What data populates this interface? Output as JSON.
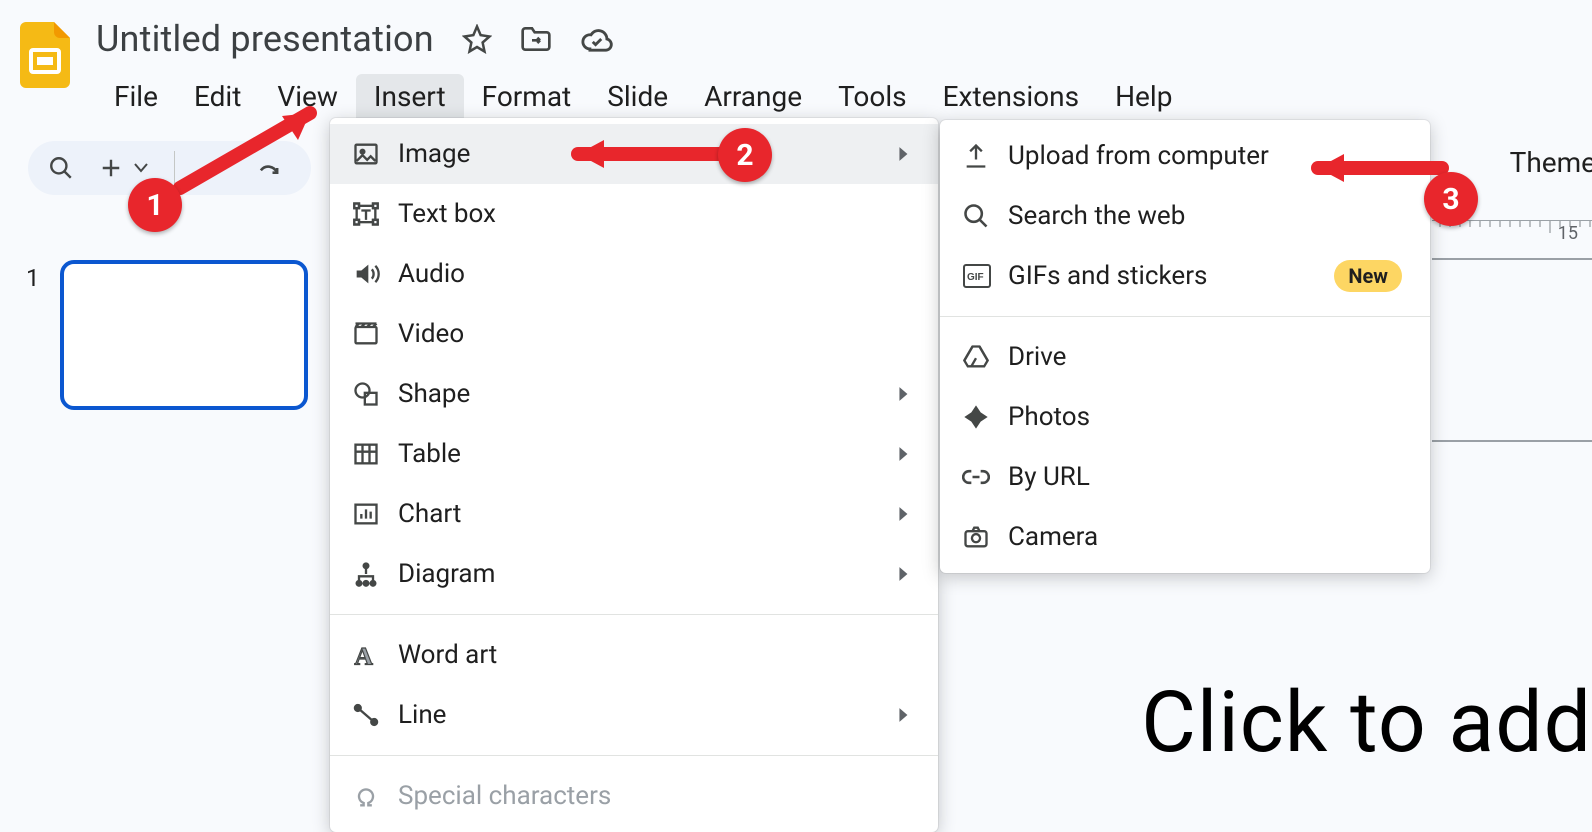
{
  "header": {
    "doc_title": "Untitled presentation"
  },
  "menubar": {
    "items": [
      "File",
      "Edit",
      "View",
      "Insert",
      "Format",
      "Slide",
      "Arrange",
      "Tools",
      "Extensions",
      "Help"
    ],
    "active_index": 3
  },
  "slide_panel": {
    "selected_slide_number": "1"
  },
  "insert_menu": {
    "items": [
      {
        "label": "Image",
        "icon": "image-icon",
        "has_submenu": true,
        "highlight": true
      },
      {
        "label": "Text box",
        "icon": "textbox-icon"
      },
      {
        "label": "Audio",
        "icon": "audio-icon"
      },
      {
        "label": "Video",
        "icon": "video-icon"
      },
      {
        "label": "Shape",
        "icon": "shape-icon",
        "has_submenu": true
      },
      {
        "label": "Table",
        "icon": "table-icon",
        "has_submenu": true
      },
      {
        "label": "Chart",
        "icon": "chart-icon",
        "has_submenu": true
      },
      {
        "label": "Diagram",
        "icon": "diagram-icon",
        "has_submenu": true
      },
      {
        "label": "Word art",
        "icon": "wordart-icon"
      },
      {
        "label": "Line",
        "icon": "line-icon",
        "has_submenu": true
      },
      {
        "label": "Special characters",
        "icon": "specialchars-icon",
        "disabled": true
      }
    ]
  },
  "image_submenu": {
    "group1": [
      {
        "label": "Upload from computer",
        "icon": "upload-icon"
      },
      {
        "label": "Search the web",
        "icon": "search-icon"
      },
      {
        "label": "GIFs and stickers",
        "icon": "gif-icon",
        "badge": "New"
      }
    ],
    "group2": [
      {
        "label": "Drive",
        "icon": "drive-icon"
      },
      {
        "label": "Photos",
        "icon": "photos-icon"
      },
      {
        "label": "By URL",
        "icon": "link-icon"
      },
      {
        "label": "Camera",
        "icon": "camera-icon"
      }
    ]
  },
  "canvas": {
    "title_placeholder": "Click to add",
    "theme_label": "Theme",
    "ruler_mark": "15"
  },
  "annotations": {
    "step1": "1",
    "step2": "2",
    "step3": "3"
  }
}
